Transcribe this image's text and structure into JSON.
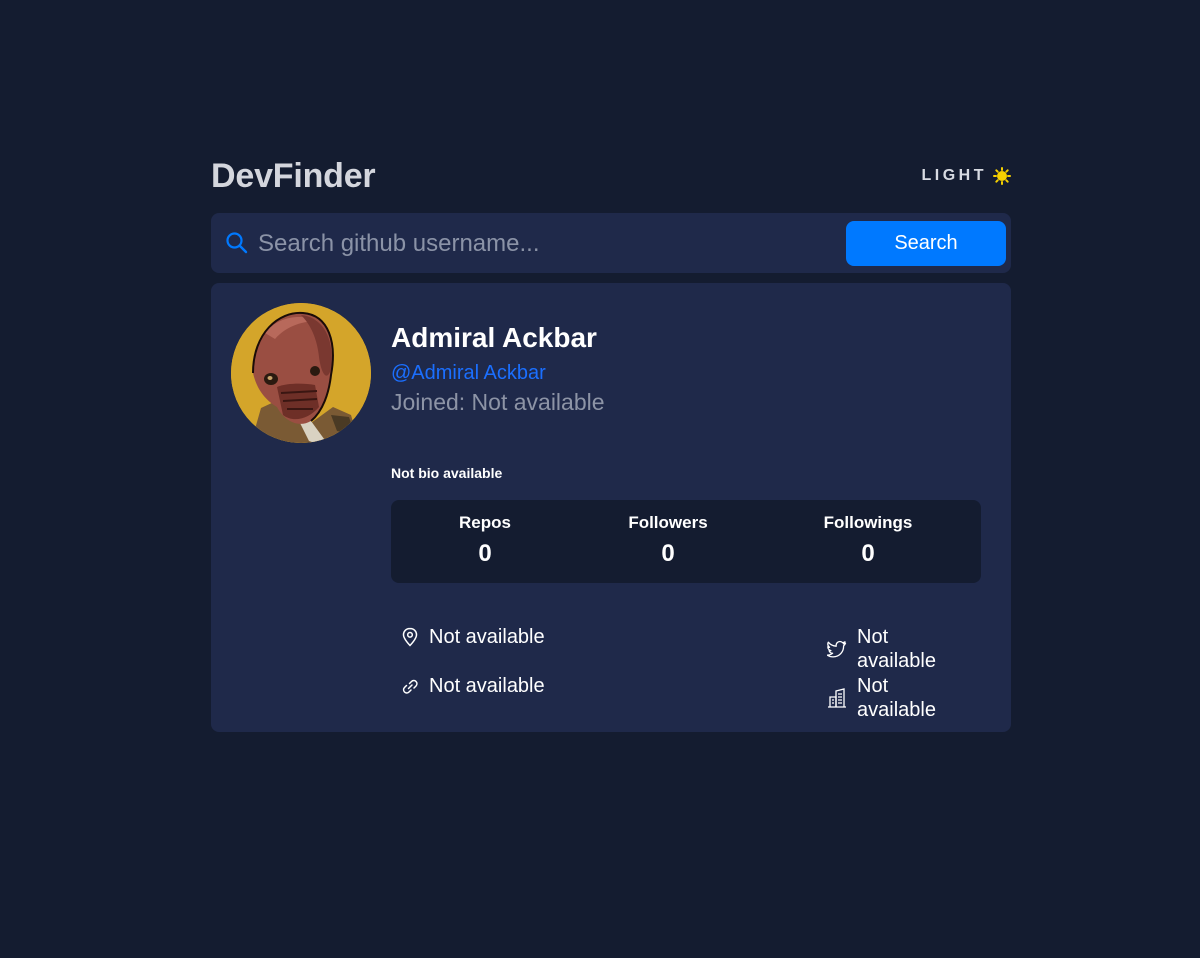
{
  "header": {
    "logo": "DevFinder",
    "theme_label": "LIGHT",
    "theme_icon": "sun-icon"
  },
  "search": {
    "placeholder": "Search github username...",
    "value": "",
    "button_label": "Search"
  },
  "profile": {
    "name": "Admiral Ackbar",
    "login": "@Admiral Ackbar",
    "joined": "Joined: Not available",
    "bio": "Not bio available",
    "avatar": "avatar-image"
  },
  "stats": [
    {
      "label": "Repos",
      "value": "0"
    },
    {
      "label": "Followers",
      "value": "0"
    },
    {
      "label": "Followings",
      "value": "0"
    }
  ],
  "links": {
    "location": {
      "icon": "location-pin-icon",
      "text": "Not available"
    },
    "twitter": {
      "icon": "twitter-icon",
      "text": "Not available"
    },
    "website": {
      "icon": "link-icon",
      "text": "Not available"
    },
    "company": {
      "icon": "building-icon",
      "text": "Not available"
    }
  },
  "colors": {
    "background": "#141c30",
    "card": "#1f294a",
    "accent": "#0079ff",
    "muted": "#8d94a6",
    "sun": "#f5d000"
  }
}
